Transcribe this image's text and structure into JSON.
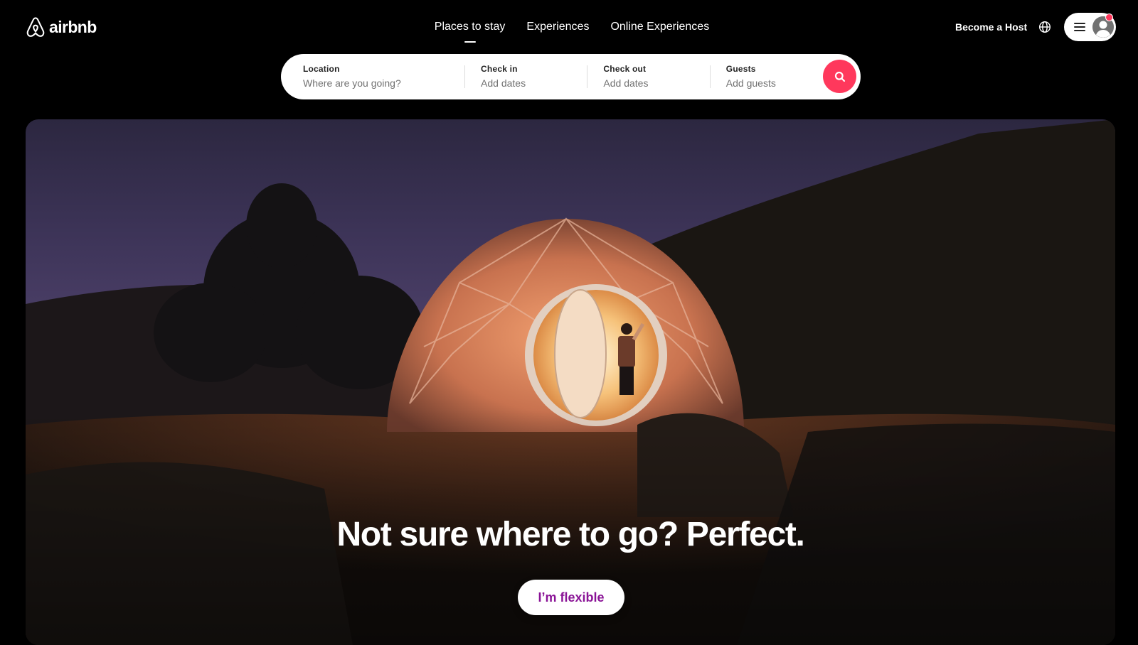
{
  "brand": {
    "name": "airbnb",
    "logo_icon": "airbnb-belo-icon",
    "accent_color": "#ff385c",
    "flexible_text_color": "#8a1396"
  },
  "nav": {
    "items": [
      {
        "label": "Places to stay",
        "active": true
      },
      {
        "label": "Experiences",
        "active": false
      },
      {
        "label": "Online Experiences",
        "active": false
      }
    ]
  },
  "header_right": {
    "host_link": "Become a Host",
    "language_icon": "globe-icon",
    "menu_icon": "hamburger-icon",
    "avatar_icon": "user-avatar-icon",
    "has_notification": true
  },
  "search": {
    "location": {
      "label": "Location",
      "placeholder": "Where are you going?"
    },
    "check_in": {
      "label": "Check in",
      "value": "Add dates"
    },
    "check_out": {
      "label": "Check out",
      "value": "Add dates"
    },
    "guests": {
      "label": "Guests",
      "value": "Add guests"
    },
    "button_icon": "search-icon"
  },
  "hero": {
    "image_description": "Illuminated geodesic dome tent at dusk with a person waving in the doorway",
    "headline": "Not sure where to go? Perfect.",
    "cta_label": "I’m flexible"
  }
}
